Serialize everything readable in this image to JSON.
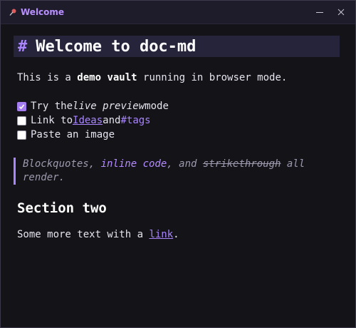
{
  "window": {
    "title": "Welcome"
  },
  "doc": {
    "h1_marker": "#",
    "h1_text": "Welcome to doc-md",
    "intro": {
      "pre": "This is a ",
      "bold": "demo vault",
      "post": " running in browser mode."
    },
    "tasks": [
      {
        "checked": true,
        "pre": "Try the ",
        "em": "live preview",
        "post": " mode"
      },
      {
        "checked": false,
        "pre": "Link to ",
        "link": "Ideas",
        "mid": " and ",
        "tag": "#tags"
      },
      {
        "checked": false,
        "text": "Paste an image"
      }
    ],
    "quote": {
      "a": "Blockquotes, ",
      "code": "inline code",
      "b": ", and ",
      "strike": "strikethrough",
      "c": " all render."
    },
    "h2": "Section two",
    "final": {
      "pre": "Some more text with a ",
      "link": "link",
      "post": "."
    }
  },
  "colors": {
    "accent": "#a985ff",
    "background": "#131318",
    "titlebar": "#1e1c2a"
  }
}
